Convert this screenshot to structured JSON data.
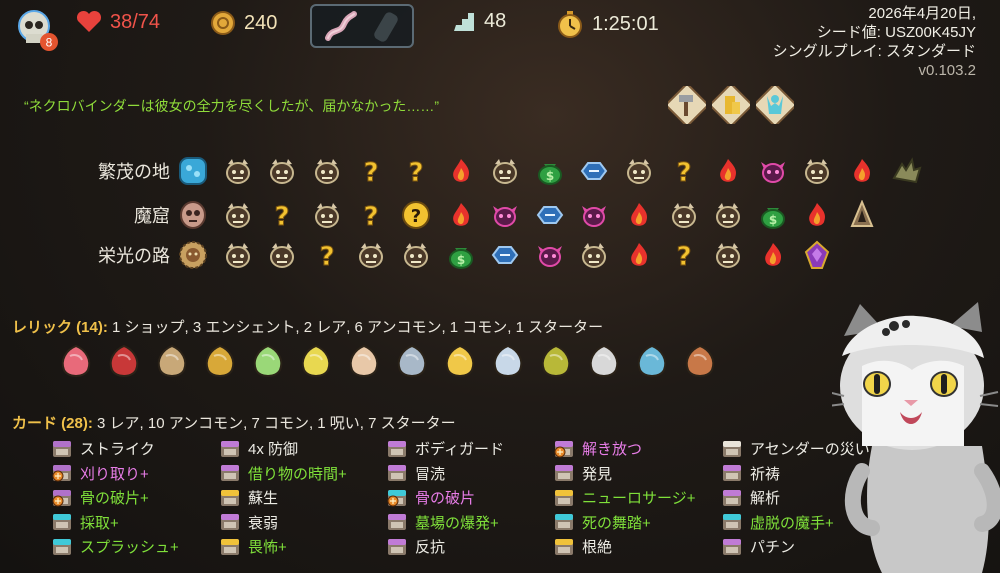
{
  "topbar": {
    "ascension": "8",
    "hp": "38/74",
    "gold": "240",
    "floor": "48",
    "time": "1:25:01",
    "potions": [
      "worm-potion",
      "empty-potion-slot"
    ]
  },
  "seed_info": {
    "date": "2026年4月20日,",
    "seed": "シード値: USZ00K45JY",
    "mode": "シングルプレイ: スタンダード",
    "version": "v0.103.2"
  },
  "quote": "“ネクロバインダーは彼女の全力を尽くしたが、届かなかった……”",
  "boss_relics": [
    "hammer-boss-relic",
    "gold-coins-boss-relic",
    "figure-boss-relic"
  ],
  "acts": [
    {
      "label": "繁茂の地",
      "nodes": [
        "act-orb-blue",
        "monster",
        "monster",
        "monster",
        "unknown",
        "unknown",
        "rest",
        "monster",
        "treasure",
        "shop",
        "monster",
        "unknown",
        "rest",
        "elite",
        "monster",
        "rest",
        "boss-thorny"
      ]
    },
    {
      "label": "魔窟",
      "nodes": [
        "act-orb-skull",
        "monster",
        "unknown",
        "monster",
        "unknown",
        "unknown-monster",
        "rest",
        "elite",
        "shop",
        "elite",
        "rest",
        "monster",
        "monster",
        "treasure",
        "rest",
        "boss-bell"
      ]
    },
    {
      "label": "栄光の路",
      "nodes": [
        "act-orb-sun",
        "monster",
        "monster",
        "unknown",
        "monster",
        "monster",
        "treasure",
        "shop",
        "elite",
        "monster",
        "rest",
        "unknown",
        "monster",
        "rest",
        "boss-gem"
      ]
    }
  ],
  "relics": {
    "title": "レリック (14):",
    "summary": " 1 ショップ,  3 エンシェント, 2 レア, 6 アンコモン, 1 コモン, 1 スターター",
    "items": [
      "heart-relic",
      "scissors-relic",
      "tent-relic",
      "pen-relic",
      "bracket-relic",
      "pear-relic",
      "bowl-relic",
      "tuning-fork-relic",
      "banana-relic",
      "map-relic",
      "hat-relic",
      "shuriken-relic",
      "tube-relic",
      "leaf-relic"
    ]
  },
  "cards": {
    "title": "カード (28):",
    "summary": " 3 レア, 10 アンコモン, 7 コモン, 1 呪い, 7 スターター",
    "columns": [
      [
        {
          "name": "ストライク",
          "style": "basic",
          "color": "#b071c9",
          "enchant": false
        },
        {
          "name": "刈り取り+",
          "style": "curse",
          "color": "#b071c9",
          "enchant": true
        },
        {
          "name": "骨の破片+",
          "style": "up",
          "color": "#b071c9",
          "enchant": true
        },
        {
          "name": "採取+",
          "style": "up",
          "color": "#3fc9d8",
          "enchant": false
        },
        {
          "name": "スプラッシュ+",
          "style": "up",
          "color": "#3fc9d8",
          "enchant": false
        }
      ],
      [
        {
          "name": "4x 防御",
          "style": "basic",
          "color": "#c07bd6",
          "enchant": false
        },
        {
          "name": "借り物の時間+",
          "style": "up",
          "color": "#c07bd6",
          "enchant": false
        },
        {
          "name": "蘇生",
          "style": "basic",
          "color": "#f0c23a",
          "enchant": false
        },
        {
          "name": "衰弱",
          "style": "basic",
          "color": "#c07bd6",
          "enchant": false
        },
        {
          "name": "畏怖+",
          "style": "up",
          "color": "#f0c23a",
          "enchant": false
        }
      ],
      [
        {
          "name": "ボディガード",
          "style": "basic",
          "color": "#c07bd6",
          "enchant": false
        },
        {
          "name": "冒涜",
          "style": "basic",
          "color": "#c07bd6",
          "enchant": false
        },
        {
          "name": "骨の破片",
          "style": "curse",
          "color": "#3fc9d8",
          "enchant": true
        },
        {
          "name": "墓場の爆発+",
          "style": "up",
          "color": "#c07bd6",
          "enchant": false
        },
        {
          "name": "反抗",
          "style": "basic",
          "color": "#c07bd6",
          "enchant": false
        }
      ],
      [
        {
          "name": "解き放つ",
          "style": "curse",
          "color": "#c07bd6",
          "enchant": true
        },
        {
          "name": "発見",
          "style": "basic",
          "color": "#c07bd6",
          "enchant": false
        },
        {
          "name": "ニューロサージ+",
          "style": "up",
          "color": "#f0c23a",
          "enchant": false
        },
        {
          "name": "死の舞踏+",
          "style": "up",
          "color": "#3fc9d8",
          "enchant": false
        },
        {
          "name": "根絶",
          "style": "basic",
          "color": "#f0c23a",
          "enchant": false
        }
      ],
      [
        {
          "name": "アセンダーの災い",
          "style": "basic",
          "color": "#e9e4da",
          "enchant": false
        },
        {
          "name": "祈祷",
          "style": "basic",
          "color": "#c07bd6",
          "enchant": false
        },
        {
          "name": "解析",
          "style": "basic",
          "color": "#c07bd6",
          "enchant": false
        },
        {
          "name": "虚脱の魔手+",
          "style": "up",
          "color": "#3fc9d8",
          "enchant": false
        },
        {
          "name": "パチン",
          "style": "basic",
          "color": "#c07bd6",
          "enchant": false
        }
      ]
    ]
  }
}
